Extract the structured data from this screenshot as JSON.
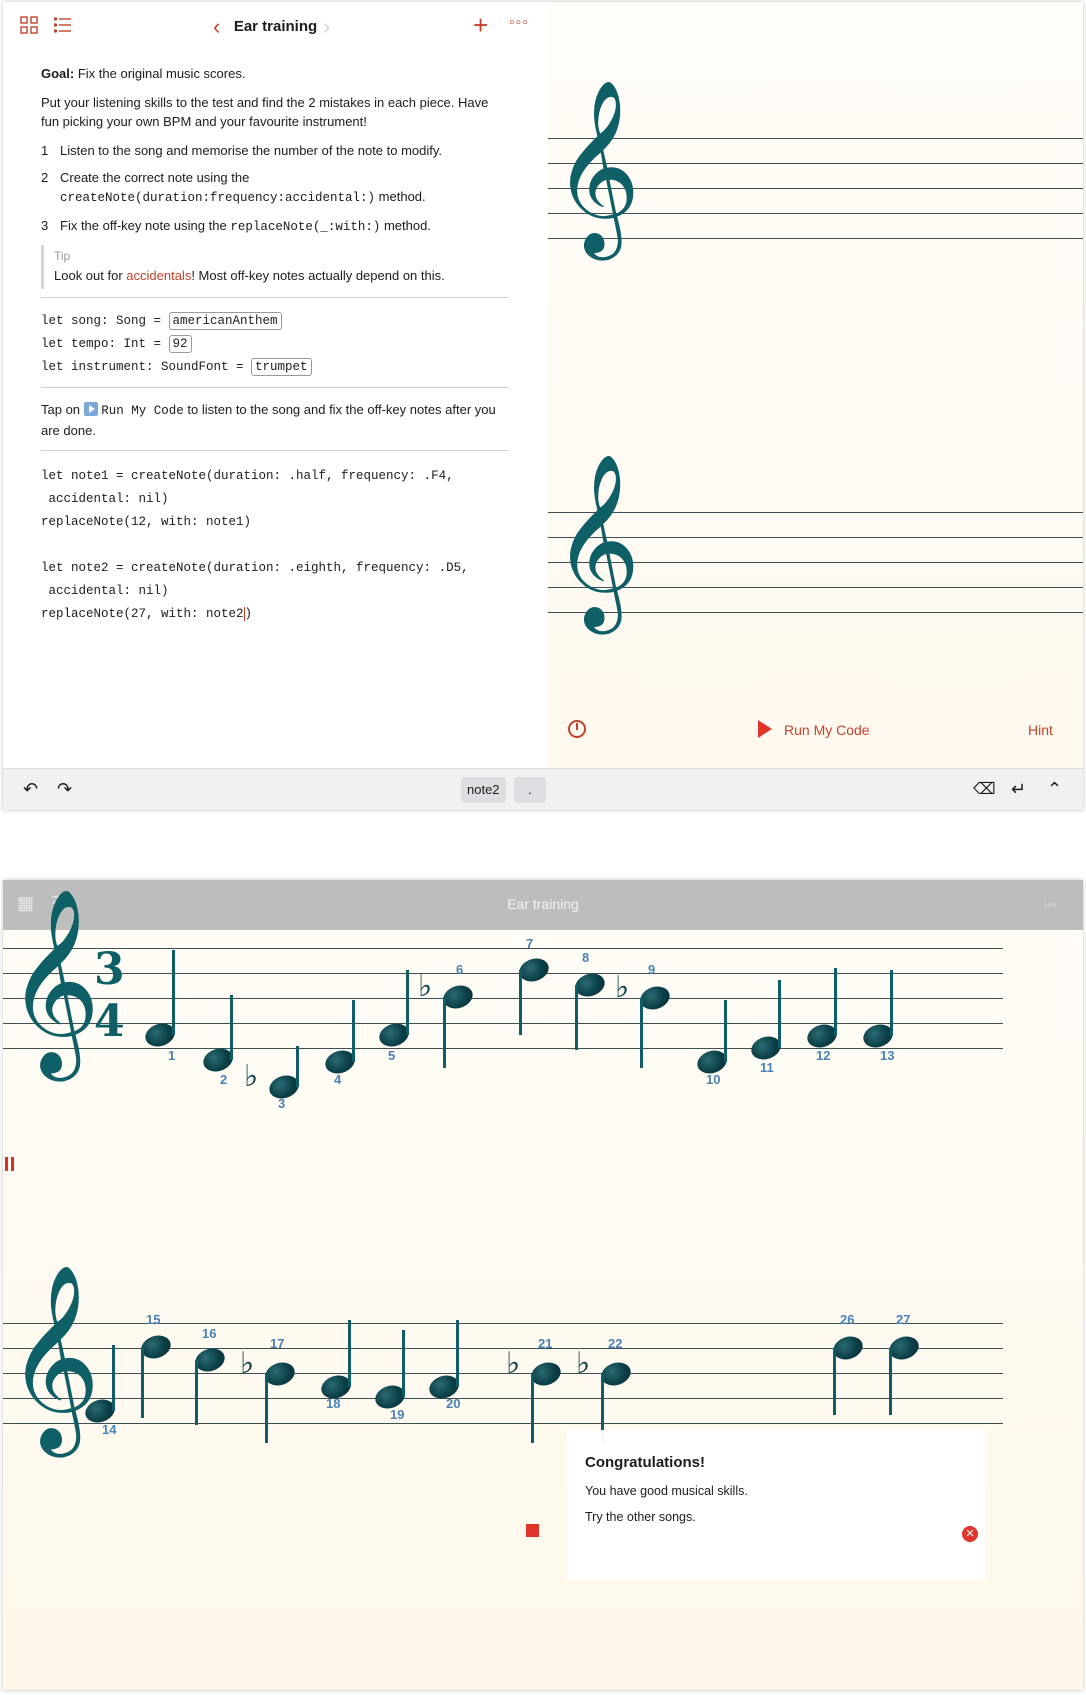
{
  "nav": {
    "title": "Ear training"
  },
  "intro": {
    "goal_label": "Goal:",
    "goal_text": " Fix the original music scores.",
    "para": "Put your listening skills to the test and find the 2 mistakes in each piece. Have fun picking your own BPM and your favourite instrument!",
    "steps": [
      {
        "num": "1",
        "pre": "Listen to the song and memorise the number of the note to modify.",
        "code": "",
        "post": ""
      },
      {
        "num": "2",
        "pre": "Create the correct note using the",
        "code": "createNote(duration:frequency:accidental:)",
        "post": " method."
      },
      {
        "num": "3",
        "pre": "Fix the off-key note using the ",
        "code": "replaceNote(_:with:)",
        "post": " method."
      }
    ],
    "tip_label": "Tip",
    "tip_pre": "Look out for ",
    "tip_link": "accidentals",
    "tip_post": "! Most off-key notes actually depend on this."
  },
  "vars": {
    "song_decl": "let song: Song = ",
    "song_val": "americanAnthem",
    "tempo_decl": "let tempo: Int = ",
    "tempo_val": "92",
    "inst_decl": "let instrument: SoundFont = ",
    "inst_val": "trumpet"
  },
  "run_hint": {
    "pre": "Tap on ",
    "code": "Run My Code",
    "post": " to listen to the song and fix the off-key notes after you are done."
  },
  "code": {
    "l1": "let note1 = createNote(duration: .half, frequency: .F4,",
    "l2": " accidental: nil)",
    "l3": "replaceNote(12, with: note1)",
    "l4": "let note2 = createNote(duration: .eighth, frequency: .D5,",
    "l5": " accidental: nil)",
    "l6a": "replaceNote(27, with: note2",
    "l6b": ")"
  },
  "live": {
    "run_label": "Run My Code",
    "hint_label": "Hint"
  },
  "keyboard": {
    "chip1": "note2",
    "chip2": "."
  },
  "score": {
    "time_sig_top": "3",
    "time_sig_bottom": "4",
    "note_numbers": [
      "1",
      "2",
      "3",
      "4",
      "5",
      "6",
      "7",
      "8",
      "9",
      "10",
      "11",
      "12",
      "13",
      "14",
      "15",
      "16",
      "17",
      "18",
      "19",
      "20",
      "21",
      "22",
      "26",
      "27"
    ]
  },
  "toast": {
    "title": "Congratulations!",
    "line1": "You have good musical skills.",
    "line2": "Try the other songs."
  },
  "colors": {
    "accent": "#c1432d",
    "note_number": "#4a82b8",
    "clef": "#0f5f66"
  }
}
